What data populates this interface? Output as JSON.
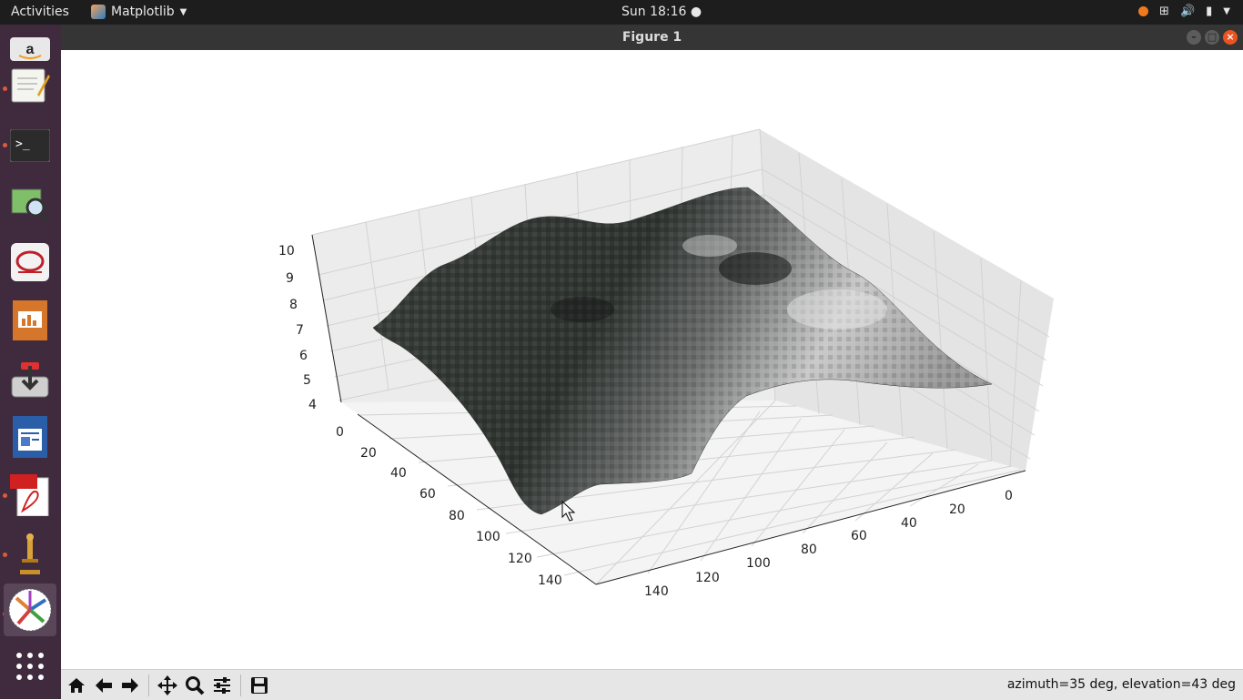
{
  "topbar": {
    "activities": "Activities",
    "app_name": "Matplotlib",
    "clock": "Sun 18:16"
  },
  "window": {
    "title": "Figure 1"
  },
  "dock": {
    "icons": [
      "amazon-icon",
      "text-editor-icon",
      "terminal-icon",
      "image-viewer-icon",
      "app-icon",
      "presentation-icon",
      "installer-icon",
      "writer-icon",
      "pdf-icon",
      "microscope-icon",
      "matplotlib-icon"
    ]
  },
  "plot": {
    "z_ticks": [
      "10",
      "9",
      "8",
      "7",
      "6",
      "5",
      "4"
    ],
    "left_ticks": [
      "0",
      "20",
      "40",
      "60",
      "80",
      "100",
      "120",
      "140"
    ],
    "right_ticks": [
      "0",
      "20",
      "40",
      "60",
      "80",
      "100",
      "120",
      "140"
    ]
  },
  "toolbar": {
    "status": "azimuth=35 deg, elevation=43 deg"
  }
}
